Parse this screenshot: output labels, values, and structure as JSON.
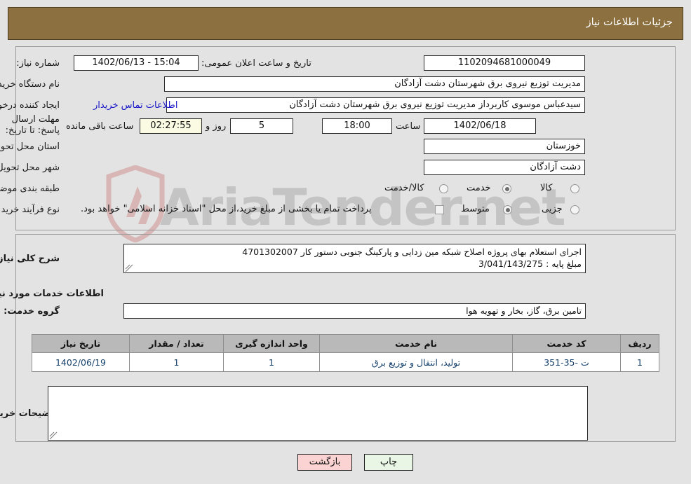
{
  "header": {
    "title": "جزئیات اطلاعات نیاز",
    "bar_color": "#8d7040"
  },
  "watermark": {
    "text": "AriaTender.net"
  },
  "form": {
    "need_number_label": "شماره نیاز:",
    "need_number_value": "1102094681000049",
    "public_announce_label": "تاریخ و ساعت اعلان عمومی:",
    "public_announce_value": "1402/06/13 - 15:04",
    "buyer_org_label": "نام دستگاه خریدار:",
    "buyer_org_value": "مدیریت توزیع نیروی برق شهرستان دشت آزادگان",
    "requester_label": "ایجاد کننده درخواست:",
    "requester_value": "سیدعباس موسوی کاربرداز مدیریت توزیع نیروی برق شهرستان دشت آزادگان",
    "contact_link": "اطلاعات تماس خریدار",
    "deadline_label": "مهلت ارسال پاسخ: تا تاریخ:",
    "deadline_date": "1402/06/18",
    "deadline_hour_label": "ساعت",
    "deadline_hour_value": "18:00",
    "remaining_days_value": "5",
    "remaining_days_label": "روز و",
    "remaining_time_value": "02:27:55",
    "remaining_time_label": "ساعت باقی مانده",
    "province_label": "استان محل تحویل:",
    "province_value": "خوزستان",
    "city_label": "شهر محل تحویل:",
    "city_value": "دشت آزادگان",
    "category_label": "طبقه بندی موضوعی:",
    "category_options": [
      {
        "label": "کالا",
        "selected": false
      },
      {
        "label": "خدمت",
        "selected": true
      },
      {
        "label": "کالا/خدمت",
        "selected": false
      }
    ],
    "process_label": "نوع فرآیند خرید :",
    "process_options": [
      {
        "label": "جزیی",
        "selected": false
      },
      {
        "label": "متوسط",
        "selected": true
      }
    ],
    "treasury_checked": false,
    "treasury_note": "پرداخت تمام یا بخشی از مبلغ خرید،از محل \"اسناد خزانه اسلامی\" خواهد بود."
  },
  "description": {
    "label": "شرح کلی نیاز;",
    "value": "اجرای استعلام بهای پروژه اصلاح شبکه مین زدایی و پارکینگ جنوبی دستور کار 4701302007\nمبلغ پایه : 3/041/143/275"
  },
  "services_section": {
    "heading": "اطلاعات خدمات مورد نیاز",
    "group_label": "گروه خدمت:",
    "group_value": "تامین برق، گاز، بخار و تهویه هوا"
  },
  "items_table": {
    "columns": [
      "ردیف",
      "کد خدمت",
      "نام خدمت",
      "واحد اندازه گیری",
      "تعداد / مقدار",
      "تاریخ نیاز"
    ],
    "rows": [
      {
        "row_no": "1",
        "service_code": "ت -35-351",
        "service_name": "تولید، انتقال و توزیع برق",
        "unit": "1",
        "quantity": "1",
        "need_date": "1402/06/19"
      }
    ]
  },
  "buyer_notes": {
    "label": "توضیحات خریدار;",
    "value": ""
  },
  "buttons": {
    "print": "چاپ",
    "back": "بازگشت"
  }
}
